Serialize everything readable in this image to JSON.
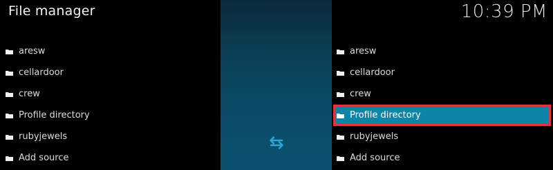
{
  "header": {
    "title": "File manager",
    "clock": "10:39 PM"
  },
  "left_pane": {
    "items": [
      {
        "label": "aresw"
      },
      {
        "label": "cellardoor"
      },
      {
        "label": "crew"
      },
      {
        "label": "Profile directory"
      },
      {
        "label": "rubyjewels"
      },
      {
        "label": "Add source"
      }
    ]
  },
  "right_pane": {
    "items": [
      {
        "label": "aresw"
      },
      {
        "label": "cellardoor"
      },
      {
        "label": "crew"
      },
      {
        "label": "Profile directory",
        "selected": true
      },
      {
        "label": "rubyjewels"
      },
      {
        "label": "Add source"
      }
    ]
  },
  "icons": {
    "folder": "folder-icon",
    "swap": "swap-arrows-icon"
  },
  "colors": {
    "accent": "#0e84a8",
    "highlight_border": "#e0353d",
    "center_panel": "#0b4a66",
    "swap_icon": "#2aa7d6"
  }
}
